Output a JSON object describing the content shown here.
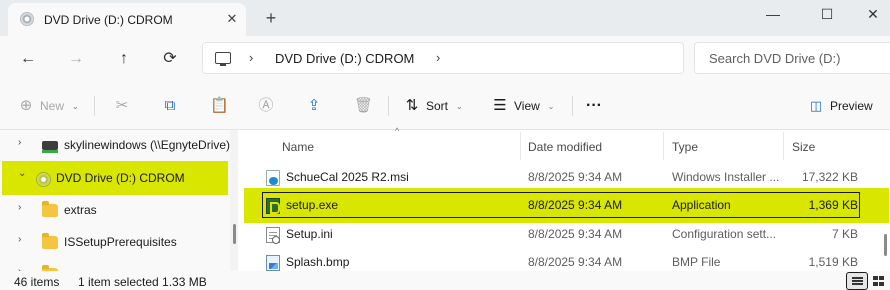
{
  "window": {
    "tab_title": "DVD Drive (D:) CDROM",
    "close_tab": "✕",
    "new_tab": "+",
    "minimize": "—",
    "maximize": "☐",
    "close": "✕"
  },
  "address": {
    "back": "←",
    "forward": "→",
    "up": "↑",
    "refresh": "⟳",
    "sep1": "›",
    "crumb": "DVD Drive (D:) CDROM",
    "sep2": "›",
    "search_placeholder": "Search DVD Drive (D:)"
  },
  "toolbar": {
    "new_label": "New",
    "sort_label": "Sort",
    "view_label": "View",
    "more_label": "···",
    "preview_label": "Preview"
  },
  "nav": {
    "items": [
      {
        "label": "skylinewindows (\\\\EgnyteDrive)",
        "chev": "›",
        "icon": "network-drive"
      },
      {
        "label": "DVD Drive (D:) CDROM",
        "chev": "⌄",
        "icon": "dvd-drive",
        "selected": true
      },
      {
        "label": "extras",
        "chev": "›",
        "icon": "folder"
      },
      {
        "label": "ISSetupPrerequisites",
        "chev": "›",
        "icon": "folder"
      },
      {
        "label": "",
        "chev": "›",
        "icon": "folder"
      }
    ]
  },
  "files": {
    "columns": {
      "name": "Name",
      "date": "Date modified",
      "type": "Type",
      "size": "Size"
    },
    "sort_indicator": "^",
    "rows": [
      {
        "name": "SchueCal 2025 R2.msi",
        "date": "8/8/2025 9:34 AM",
        "type": "Windows Installer ...",
        "size": "17,322 KB",
        "icon": "msi"
      },
      {
        "name": "setup.exe",
        "date": "8/8/2025 9:34 AM",
        "type": "Application",
        "size": "1,369 KB",
        "icon": "exe",
        "selected": true
      },
      {
        "name": "Setup.ini",
        "date": "8/8/2025 9:34 AM",
        "type": "Configuration sett...",
        "size": "7 KB",
        "icon": "ini"
      },
      {
        "name": "Splash.bmp",
        "date": "8/8/2025 9:34 AM",
        "type": "BMP File",
        "size": "1,519 KB",
        "icon": "bmp"
      }
    ]
  },
  "status": {
    "item_count": "46 items",
    "selection": "1 item selected  1.33 MB"
  },
  "colors": {
    "highlight": "#d8e600",
    "accent": "#0067c0"
  }
}
